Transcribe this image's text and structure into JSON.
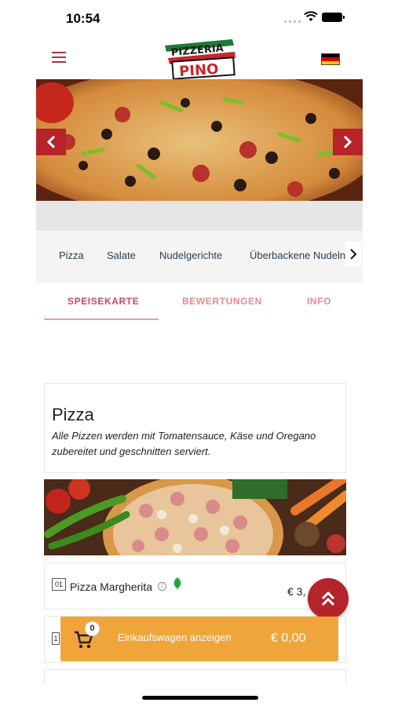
{
  "status_bar": {
    "time": "10:54"
  },
  "header": {
    "logo_text_top": "PIZZERIA",
    "logo_text_bottom": "PINO",
    "menu_icon": "hamburger-icon",
    "language_flag": "german-flag-icon"
  },
  "hero": {
    "prev_icon": "chevron-left-icon",
    "next_icon": "chevron-right-icon"
  },
  "categories": {
    "items": [
      "Pizza",
      "Salate",
      "Nudelgerichte",
      "Überbackene Nudeln"
    ],
    "next_icon": "chevron-right-icon"
  },
  "tabs": [
    {
      "label": "SPEISEKARTE",
      "active": true
    },
    {
      "label": "BEWERTUNGEN",
      "active": false
    },
    {
      "label": "INFO",
      "active": false
    }
  ],
  "section": {
    "title": "Pizza",
    "description": "Alle Pizzen werden mit Tomatensauce, Käse und Oregano zubereitet und geschnitten serviert."
  },
  "items": [
    {
      "number": "01",
      "name": "Pizza Margherita",
      "price": "€ 3,"
    },
    {
      "number": "1",
      "name": "",
      "price": ""
    }
  ],
  "cart": {
    "count": "0",
    "label": "Einkaufswagen anzeigen",
    "total": "€ 0,00"
  },
  "colors": {
    "brand_red": "#b5232b",
    "tab_pink": "#d0485a",
    "cart_orange": "#f0a53b"
  }
}
